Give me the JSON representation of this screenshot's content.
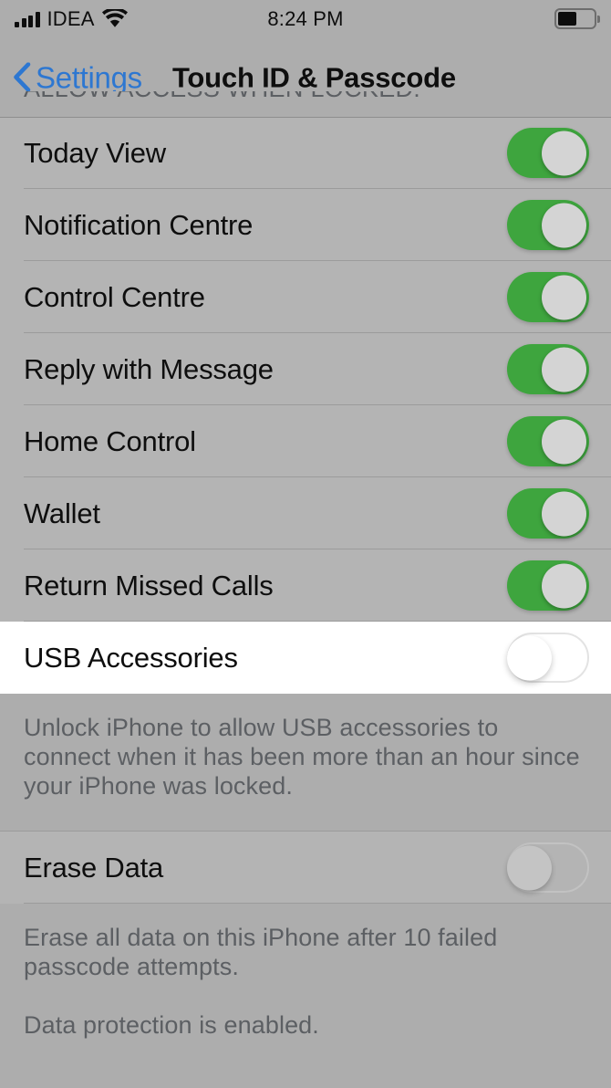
{
  "status_bar": {
    "carrier": "IDEA",
    "time": "8:24 PM",
    "signal_icon": "signal-bars-icon",
    "wifi_icon": "wifi-icon",
    "battery_icon": "battery-icon",
    "battery_level_percent": 48
  },
  "nav": {
    "back_label": "Settings",
    "back_icon": "chevron-left-icon",
    "title": "Touch ID & Passcode"
  },
  "sections": {
    "allow_access_header": "ALLOW ACCESS WHEN LOCKED:",
    "usb_footnote": "Unlock iPhone to allow USB accessories to connect when it has been more than an hour since your iPhone was locked.",
    "erase_footnote_1": "Erase all data on this iPhone after 10 failed passcode attempts.",
    "erase_footnote_2": "Data protection is enabled."
  },
  "rows": [
    {
      "label": "Today View",
      "state": "on",
      "highlighted": false
    },
    {
      "label": "Notification Centre",
      "state": "on",
      "highlighted": false
    },
    {
      "label": "Control Centre",
      "state": "on",
      "highlighted": false
    },
    {
      "label": "Reply with Message",
      "state": "on",
      "highlighted": false
    },
    {
      "label": "Home Control",
      "state": "on",
      "highlighted": false
    },
    {
      "label": "Wallet",
      "state": "on",
      "highlighted": false
    },
    {
      "label": "Return Missed Calls",
      "state": "on",
      "highlighted": false
    },
    {
      "label": "USB Accessories",
      "state": "off",
      "highlighted": true
    }
  ],
  "erase_row": {
    "label": "Erase Data",
    "state": "off",
    "highlighted": false
  },
  "colors": {
    "accent_blue": "#2d77d1",
    "toggle_on_green": "#3ea53e",
    "page_background": "#adadad",
    "row_background": "#b4b4b4",
    "highlight_background": "#ffffff",
    "primary_text": "#0e0e0e",
    "secondary_text": "#5c5f63"
  }
}
